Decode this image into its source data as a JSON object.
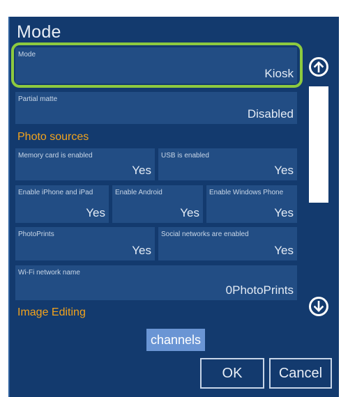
{
  "window": {
    "title": "Mode"
  },
  "fields": {
    "mode": {
      "label": "Mode",
      "value": "Kiosk"
    },
    "partial_matte": {
      "label": "Partial matte",
      "value": "Disabled"
    }
  },
  "photo_sources": {
    "heading": "Photo sources",
    "memory_card": {
      "label": "Memory card is enabled",
      "value": "Yes"
    },
    "usb": {
      "label": "USB is enabled",
      "value": "Yes"
    },
    "iphone_ipad": {
      "label": "Enable iPhone and iPad",
      "value": "Yes"
    },
    "android": {
      "label": "Enable Android",
      "value": "Yes"
    },
    "windows_phone": {
      "label": "Enable Windows Phone",
      "value": "Yes"
    },
    "photoprints": {
      "label": "PhotoPrints",
      "value": "Yes"
    },
    "social_networks": {
      "label": "Social networks are enabled",
      "value": "Yes"
    },
    "wifi_name": {
      "label": "Wi-Fi network name",
      "value": "0PhotoPrints"
    }
  },
  "image_editing": {
    "heading": "Image Editing",
    "chip": "channels"
  },
  "buttons": {
    "ok": "OK",
    "cancel": "Cancel"
  },
  "colors": {
    "background": "#133a6e",
    "tile": "#224d84",
    "accent_orange": "#f2a31d",
    "highlight_green": "#8dca3f",
    "chip_blue": "#6a95d4"
  },
  "icons": {
    "scroll_up": "arrow-up-circle-icon",
    "scroll_down": "arrow-down-circle-icon"
  }
}
